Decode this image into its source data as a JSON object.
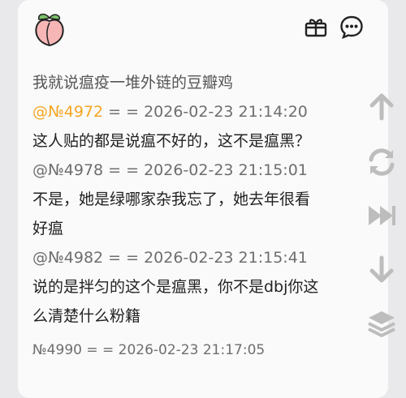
{
  "thread": {
    "lines": [
      {
        "text": "我就说瘟疫一堆外链的豆瓣鸡",
        "style": "muted"
      },
      {
        "ref": "@№4972",
        "rest": " = = 2026-02-23 21:14:20",
        "style": "meta"
      },
      {
        "text": "这人贴的都是说瘟不好的，这不是瘟黑？",
        "style": "dark"
      },
      {
        "text": "@№4978 = = 2026-02-23 21:15:01",
        "style": "meta"
      },
      {
        "text": "不是，她是绿哪家杂我忘了，她去年很看",
        "style": "dark"
      },
      {
        "text": "好瘟",
        "style": "dark"
      },
      {
        "text": "@№4982 = = 2026-02-23 21:15:41",
        "style": "meta"
      },
      {
        "text": "说的是拌匀的这个是瘟黑，你不是dbj你这",
        "style": "dark"
      },
      {
        "text": "么清楚什么粉籍",
        "style": "dark"
      },
      {
        "text": "№4990 = = 2026-02-23 21:17:05",
        "style": "small"
      }
    ]
  },
  "icons": {
    "avatar": "peach-icon",
    "toolbar": [
      "gift-icon",
      "chat-bubble-icon"
    ],
    "sidebar": [
      "arrow-up-icon",
      "refresh-icon",
      "fast-forward-icon",
      "arrow-down-icon",
      "layers-icon"
    ]
  },
  "colors": {
    "accent_ref": "#f5a623",
    "icon_gray": "#bdbdbd",
    "peach": "#f6b6b6"
  }
}
